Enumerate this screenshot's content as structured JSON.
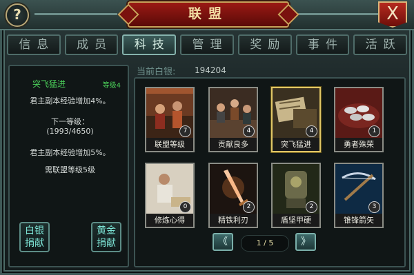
{
  "header": {
    "title": "联盟",
    "help_label": "?",
    "close_label": "X"
  },
  "tabs": [
    {
      "label": "信息",
      "active": false
    },
    {
      "label": "成员",
      "active": false
    },
    {
      "label": "科技",
      "active": true
    },
    {
      "label": "管理",
      "active": false
    },
    {
      "label": "奖励",
      "active": false
    },
    {
      "label": "事件",
      "active": false
    },
    {
      "label": "活跃",
      "active": false
    }
  ],
  "detail": {
    "tech_name": "突飞猛进",
    "level": "等级4",
    "current_effect": "君主副本经验增加4%。",
    "next_level_label": "下一等级：",
    "progress": "(1993/4650)",
    "next_effect": "君主副本经验增加5%。",
    "requirement": "需联盟等级5级",
    "donate_silver": [
      "白银",
      "捐献"
    ],
    "donate_gold": [
      "黄金",
      "捐献"
    ]
  },
  "silver": {
    "label": "当前白银:",
    "value": "194204"
  },
  "techs": [
    {
      "name": "联盟等级",
      "level": "7",
      "icon": "alliance-meeting-icon",
      "selected": false
    },
    {
      "name": "贡献良多",
      "level": "4",
      "icon": "generals-council-icon",
      "selected": false
    },
    {
      "name": "突飞猛进",
      "level": "4",
      "icon": "book-scroll-icon",
      "selected": true
    },
    {
      "name": "勇者殊荣",
      "level": "1",
      "icon": "silver-ingots-icon",
      "selected": false
    },
    {
      "name": "修炼心得",
      "level": "0",
      "icon": "scholar-writing-icon",
      "selected": false
    },
    {
      "name": "精铁利刃",
      "level": "2",
      "icon": "glowing-sword-icon",
      "selected": false
    },
    {
      "name": "盾坚甲硬",
      "level": "2",
      "icon": "armor-icon",
      "selected": false
    },
    {
      "name": "锥锋箭矢",
      "level": "3",
      "icon": "crossbow-icon",
      "selected": false
    }
  ],
  "pager": {
    "text": "1 / 5",
    "prev": "《",
    "next": "》"
  },
  "colors": {
    "accent_red": "#9a1a14",
    "gold_border": "#c7a25a",
    "level_green": "#4bd15a",
    "teal": "#7de5d6"
  }
}
